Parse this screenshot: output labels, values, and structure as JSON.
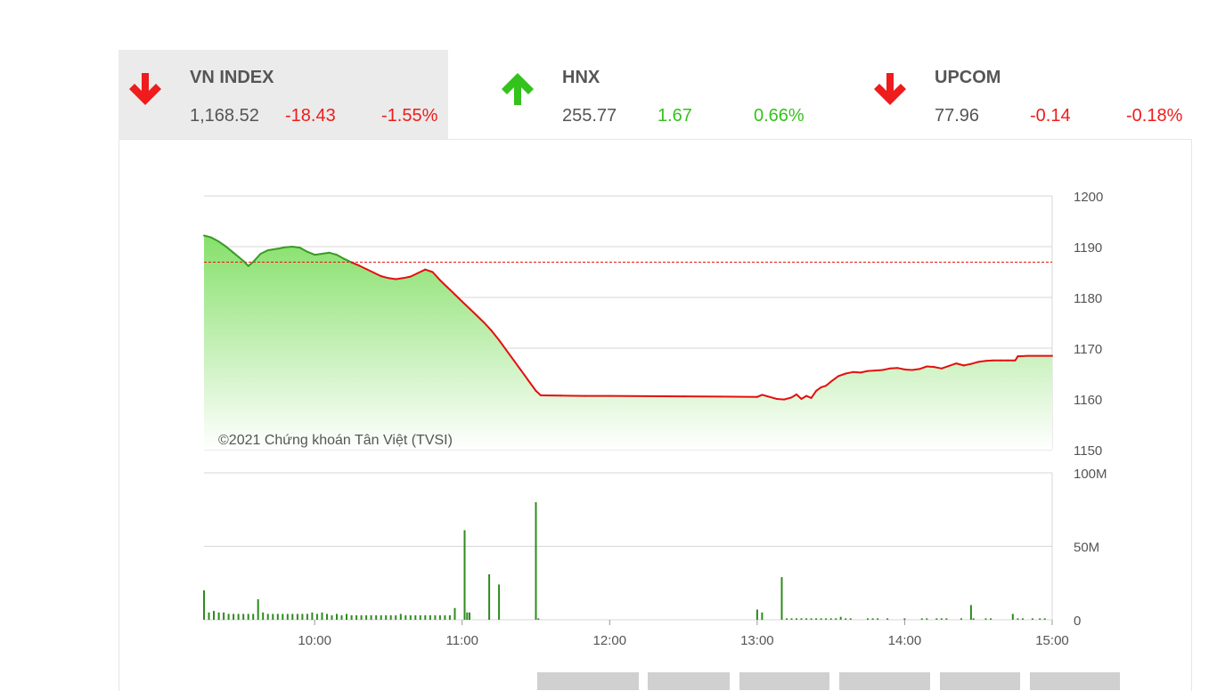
{
  "indices": [
    {
      "name": "VN INDEX",
      "value": "1,168.52",
      "change": "-18.43",
      "percent": "-1.55%",
      "direction": "down",
      "active": true
    },
    {
      "name": "HNX",
      "value": "255.77",
      "change": "1.67",
      "percent": "0.66%",
      "direction": "up",
      "active": false
    },
    {
      "name": "UPCOM",
      "value": "77.96",
      "change": "-0.14",
      "percent": "-0.18%",
      "direction": "down",
      "active": false
    }
  ],
  "colors": {
    "down": "#ee1c1c",
    "up": "#34c21c",
    "line": "#e40f0f",
    "reference": "#e40f0f",
    "volume": "#2e8b1e",
    "fill_top": "#86e06a",
    "fill_bottom": "#ffffff",
    "grid": "#d7d7d7"
  },
  "chart_data": {
    "type": "line",
    "watermark": "©2021 Chứng khoán Tân Việt (TVSI)",
    "price": {
      "ylim": [
        1150,
        1200
      ],
      "yticks": [
        "1200",
        "1190",
        "1180",
        "1170",
        "1160",
        "1150"
      ],
      "reference": 1186.95,
      "points": [
        [
          "09:15",
          1192.2
        ],
        [
          "09:18",
          1191.8
        ],
        [
          "09:21",
          1191.0
        ],
        [
          "09:24",
          1190.0
        ],
        [
          "09:27",
          1188.8
        ],
        [
          "09:29",
          1188.0
        ],
        [
          "09:31",
          1187.2
        ],
        [
          "09:33",
          1186.2
        ],
        [
          "09:35",
          1187.0
        ],
        [
          "09:38",
          1188.6
        ],
        [
          "09:41",
          1189.3
        ],
        [
          "09:45",
          1189.6
        ],
        [
          "09:48",
          1189.9
        ],
        [
          "09:51",
          1190.0
        ],
        [
          "09:54",
          1189.8
        ],
        [
          "09:57",
          1189.0
        ],
        [
          "10:00",
          1188.4
        ],
        [
          "10:03",
          1188.6
        ],
        [
          "10:06",
          1188.8
        ],
        [
          "10:09",
          1188.4
        ],
        [
          "10:12",
          1187.6
        ],
        [
          "10:15",
          1186.9
        ],
        [
          "10:18",
          1186.3
        ],
        [
          "10:21",
          1185.6
        ],
        [
          "10:24",
          1184.9
        ],
        [
          "10:27",
          1184.2
        ],
        [
          "10:30",
          1183.8
        ],
        [
          "10:33",
          1183.6
        ],
        [
          "10:36",
          1183.8
        ],
        [
          "10:39",
          1184.1
        ],
        [
          "10:42",
          1184.8
        ],
        [
          "10:45",
          1185.5
        ],
        [
          "10:48",
          1185.0
        ],
        [
          "10:51",
          1183.4
        ],
        [
          "10:54",
          1182.0
        ],
        [
          "10:57",
          1180.6
        ],
        [
          "11:00",
          1179.2
        ],
        [
          "11:03",
          1177.8
        ],
        [
          "11:06",
          1176.4
        ],
        [
          "11:09",
          1175.0
        ],
        [
          "11:12",
          1173.4
        ],
        [
          "11:15",
          1171.6
        ],
        [
          "11:18",
          1169.6
        ],
        [
          "11:21",
          1167.6
        ],
        [
          "11:24",
          1165.6
        ],
        [
          "11:27",
          1163.6
        ],
        [
          "11:30",
          1161.6
        ],
        [
          "11:32",
          1160.7
        ],
        [
          "11:40",
          1160.65
        ],
        [
          "11:50",
          1160.6
        ],
        [
          "12:00",
          1160.6
        ],
        [
          "12:15",
          1160.55
        ],
        [
          "12:30",
          1160.5
        ],
        [
          "12:45",
          1160.45
        ],
        [
          "13:00",
          1160.4
        ],
        [
          "13:02",
          1160.8
        ],
        [
          "13:05",
          1160.4
        ],
        [
          "13:08",
          1160.0
        ],
        [
          "13:11",
          1159.9
        ],
        [
          "13:14",
          1160.3
        ],
        [
          "13:16",
          1160.9
        ],
        [
          "13:18",
          1160.0
        ],
        [
          "13:20",
          1160.6
        ],
        [
          "13:22",
          1160.2
        ],
        [
          "13:24",
          1161.6
        ],
        [
          "13:26",
          1162.3
        ],
        [
          "13:28",
          1162.6
        ],
        [
          "13:30",
          1163.4
        ],
        [
          "13:33",
          1164.5
        ],
        [
          "13:36",
          1165.0
        ],
        [
          "13:39",
          1165.3
        ],
        [
          "13:42",
          1165.2
        ],
        [
          "13:45",
          1165.5
        ],
        [
          "13:48",
          1165.6
        ],
        [
          "13:51",
          1165.7
        ],
        [
          "13:54",
          1166.0
        ],
        [
          "13:57",
          1166.1
        ],
        [
          "14:00",
          1165.8
        ],
        [
          "14:03",
          1165.7
        ],
        [
          "14:06",
          1165.9
        ],
        [
          "14:09",
          1166.4
        ],
        [
          "14:12",
          1166.3
        ],
        [
          "14:15",
          1166.0
        ],
        [
          "14:18",
          1166.5
        ],
        [
          "14:21",
          1167.0
        ],
        [
          "14:24",
          1166.6
        ],
        [
          "14:27",
          1166.9
        ],
        [
          "14:30",
          1167.3
        ],
        [
          "14:33",
          1167.5
        ],
        [
          "14:36",
          1167.6
        ],
        [
          "14:39",
          1167.6
        ],
        [
          "14:42",
          1167.6
        ],
        [
          "14:45",
          1167.6
        ],
        [
          "14:46",
          1168.4
        ],
        [
          "14:50",
          1168.5
        ],
        [
          "14:55",
          1168.5
        ],
        [
          "15:00",
          1168.5
        ]
      ]
    },
    "volume": {
      "ylim": [
        0,
        100
      ],
      "yticks": [
        "100M",
        "50M",
        "0"
      ],
      "unit": "M",
      "points": [
        [
          "09:15",
          20
        ],
        [
          "09:17",
          5
        ],
        [
          "09:19",
          6
        ],
        [
          "09:21",
          5
        ],
        [
          "09:23",
          5
        ],
        [
          "09:25",
          4
        ],
        [
          "09:27",
          4
        ],
        [
          "09:29",
          4
        ],
        [
          "09:31",
          4
        ],
        [
          "09:33",
          4
        ],
        [
          "09:35",
          4
        ],
        [
          "09:37",
          14
        ],
        [
          "09:39",
          5
        ],
        [
          "09:41",
          4
        ],
        [
          "09:43",
          4
        ],
        [
          "09:45",
          4
        ],
        [
          "09:47",
          4
        ],
        [
          "09:49",
          4
        ],
        [
          "09:51",
          4
        ],
        [
          "09:53",
          4
        ],
        [
          "09:55",
          4
        ],
        [
          "09:57",
          4
        ],
        [
          "09:59",
          5
        ],
        [
          "10:01",
          4
        ],
        [
          "10:03",
          5
        ],
        [
          "10:05",
          4
        ],
        [
          "10:07",
          3
        ],
        [
          "10:09",
          4
        ],
        [
          "10:11",
          3
        ],
        [
          "10:13",
          4
        ],
        [
          "10:15",
          3
        ],
        [
          "10:17",
          3
        ],
        [
          "10:19",
          3
        ],
        [
          "10:21",
          3
        ],
        [
          "10:23",
          3
        ],
        [
          "10:25",
          3
        ],
        [
          "10:27",
          3
        ],
        [
          "10:29",
          3
        ],
        [
          "10:31",
          3
        ],
        [
          "10:33",
          3
        ],
        [
          "10:35",
          4
        ],
        [
          "10:37",
          3
        ],
        [
          "10:39",
          3
        ],
        [
          "10:41",
          3
        ],
        [
          "10:43",
          3
        ],
        [
          "10:45",
          3
        ],
        [
          "10:47",
          3
        ],
        [
          "10:49",
          3
        ],
        [
          "10:51",
          3
        ],
        [
          "10:53",
          3
        ],
        [
          "10:55",
          3
        ],
        [
          "10:57",
          8
        ],
        [
          "11:01",
          61
        ],
        [
          "11:02",
          5
        ],
        [
          "11:03",
          5
        ],
        [
          "11:11",
          31
        ],
        [
          "11:15",
          24
        ],
        [
          "11:30",
          80
        ],
        [
          "11:31",
          1
        ],
        [
          "13:00",
          7
        ],
        [
          "13:02",
          5
        ],
        [
          "13:10",
          29
        ],
        [
          "13:12",
          1
        ],
        [
          "13:14",
          1
        ],
        [
          "13:16",
          1
        ],
        [
          "13:18",
          1
        ],
        [
          "13:20",
          1
        ],
        [
          "13:22",
          1
        ],
        [
          "13:24",
          1
        ],
        [
          "13:26",
          1
        ],
        [
          "13:28",
          1
        ],
        [
          "13:30",
          1
        ],
        [
          "13:32",
          1
        ],
        [
          "13:34",
          2
        ],
        [
          "13:36",
          1
        ],
        [
          "13:38",
          1
        ],
        [
          "13:45",
          1
        ],
        [
          "13:47",
          1
        ],
        [
          "13:49",
          1
        ],
        [
          "13:53",
          1
        ],
        [
          "14:00",
          1
        ],
        [
          "14:07",
          1
        ],
        [
          "14:09",
          1
        ],
        [
          "14:13",
          1
        ],
        [
          "14:15",
          1
        ],
        [
          "14:17",
          1
        ],
        [
          "14:23",
          1
        ],
        [
          "14:27",
          10
        ],
        [
          "14:28",
          1
        ],
        [
          "14:33",
          1
        ],
        [
          "14:35",
          1
        ],
        [
          "14:44",
          4
        ],
        [
          "14:46",
          1
        ],
        [
          "14:48",
          1
        ],
        [
          "14:52",
          1
        ],
        [
          "14:55",
          1
        ],
        [
          "14:57",
          1
        ]
      ]
    },
    "xticks": [
      "10:00",
      "11:00",
      "12:00",
      "13:00",
      "14:00",
      "15:00"
    ],
    "x_range": [
      "09:15",
      "15:00"
    ],
    "grid": true
  }
}
